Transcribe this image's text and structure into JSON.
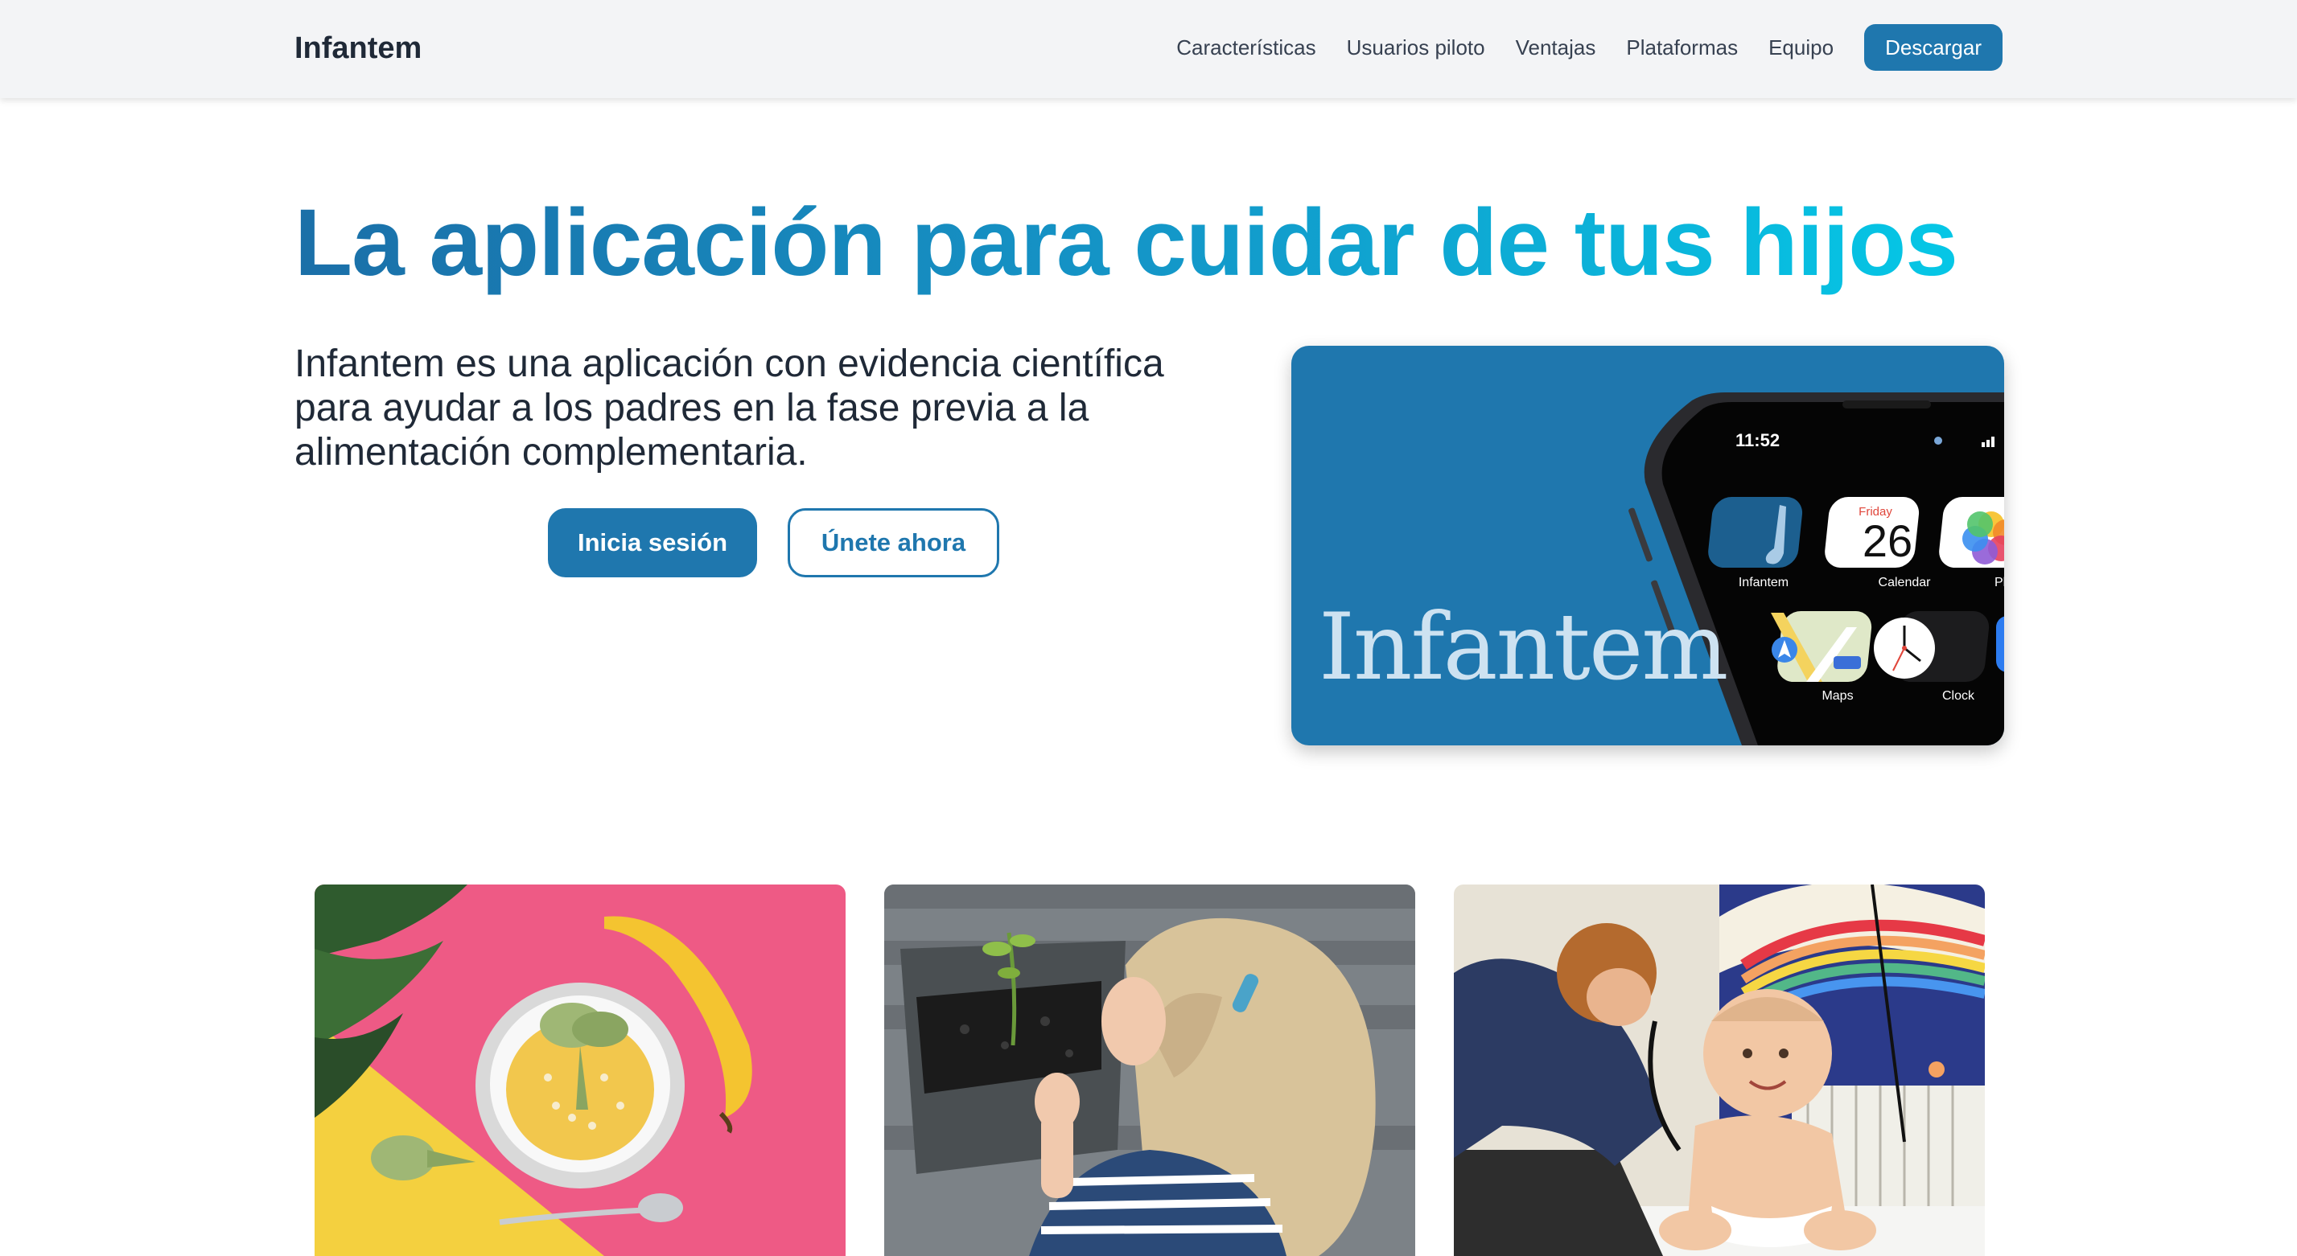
{
  "brand": "Infantem",
  "nav": {
    "links": [
      "Características",
      "Usuarios piloto",
      "Ventajas",
      "Plataformas",
      "Equipo"
    ],
    "cta": "Descargar"
  },
  "hero": {
    "title": "La aplicación para cuidar de tus hijos",
    "description": "Infantem es una aplicación con evidencia científica para ayudar a los padres en la fase previa a la alimentación complementaria.",
    "login_button": "Inicia sesión",
    "signup_button": "Únete ahora"
  },
  "promo": {
    "wordmark": "Infantem",
    "phone_time": "11:52",
    "apps": [
      {
        "label": "Infantem",
        "icon": "spoon-icon"
      },
      {
        "label": "Calendar",
        "icon": "calendar-icon",
        "day": "Friday",
        "date": "26"
      },
      {
        "label": "Ph",
        "icon": "photos-icon"
      },
      {
        "label": "Maps",
        "icon": "maps-icon"
      },
      {
        "label": "Clock",
        "icon": "clock-icon"
      }
    ]
  },
  "photos": [
    {
      "subject": "bowl-banana-photo"
    },
    {
      "subject": "child-plant-photo"
    },
    {
      "subject": "doctor-baby-photo"
    }
  ],
  "colors": {
    "accent": "#1f77ae",
    "title_gradient_start": "#1b6fa8",
    "title_gradient_end": "#05c7e6",
    "navbar_bg": "#f3f4f6"
  }
}
